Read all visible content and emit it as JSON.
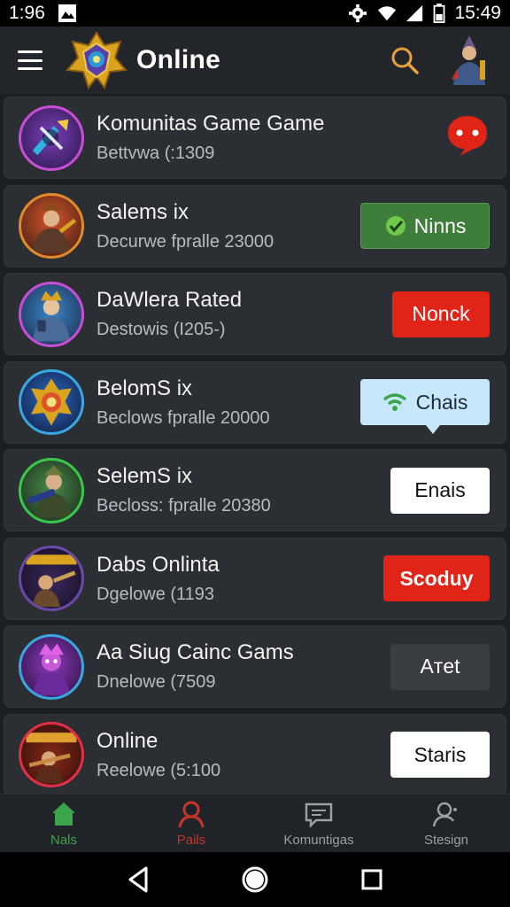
{
  "status_bar": {
    "time_left": "1:96",
    "time_right": "15:49"
  },
  "app_bar": {
    "title": "Online"
  },
  "rows": [
    {
      "title": "Komunitas Game Game",
      "subtitle": "Bettvwa (:1309",
      "action": {
        "type": "chat-bubble",
        "label": ""
      }
    },
    {
      "title": "Salems ix",
      "subtitle": "Decurwe fpralle 23000",
      "action": {
        "type": "green",
        "label": "Ninns"
      }
    },
    {
      "title": "DaWlera Rated",
      "subtitle": "Destowis (I205-)",
      "action": {
        "type": "red",
        "label": "Nonck"
      }
    },
    {
      "title": "BelomS ix",
      "subtitle": "Beclows fpralle 20000",
      "action": {
        "type": "blue",
        "label": "Chais"
      }
    },
    {
      "title": "SelemS ix",
      "subtitle": "Becloss: fpralle 20380",
      "action": {
        "type": "white",
        "label": "Enais"
      }
    },
    {
      "title": "Dabs Onlinta",
      "subtitle": "Dgelowe (1193",
      "action": {
        "type": "red-wide",
        "label": "Scoduy"
      }
    },
    {
      "title": "Aa Siug Cainc Gams",
      "subtitle": "Dnelowe (7509",
      "action": {
        "type": "dark",
        "label": "Aтet"
      }
    },
    {
      "title": "Online",
      "subtitle": "Reelowe (5:100",
      "action": {
        "type": "white",
        "label": "Staris"
      }
    }
  ],
  "bottom_nav": [
    {
      "label": "Nals",
      "icon": "home-icon",
      "color": "#3aa54a"
    },
    {
      "label": "Pails",
      "icon": "user-icon",
      "color": "#c8342b"
    },
    {
      "label": "Komuntigas",
      "icon": "chat-icon",
      "color": "#9aa0a6"
    },
    {
      "label": "Stesign",
      "icon": "profile-search-icon",
      "color": "#9aa0a6"
    }
  ],
  "colors": {
    "background": "#1c1f22",
    "row": "#2b2e33",
    "accent_green": "#3f7d3a",
    "accent_red": "#e02418",
    "accent_blue": "#c7e7fa",
    "search_orange": "#e8a23a"
  }
}
